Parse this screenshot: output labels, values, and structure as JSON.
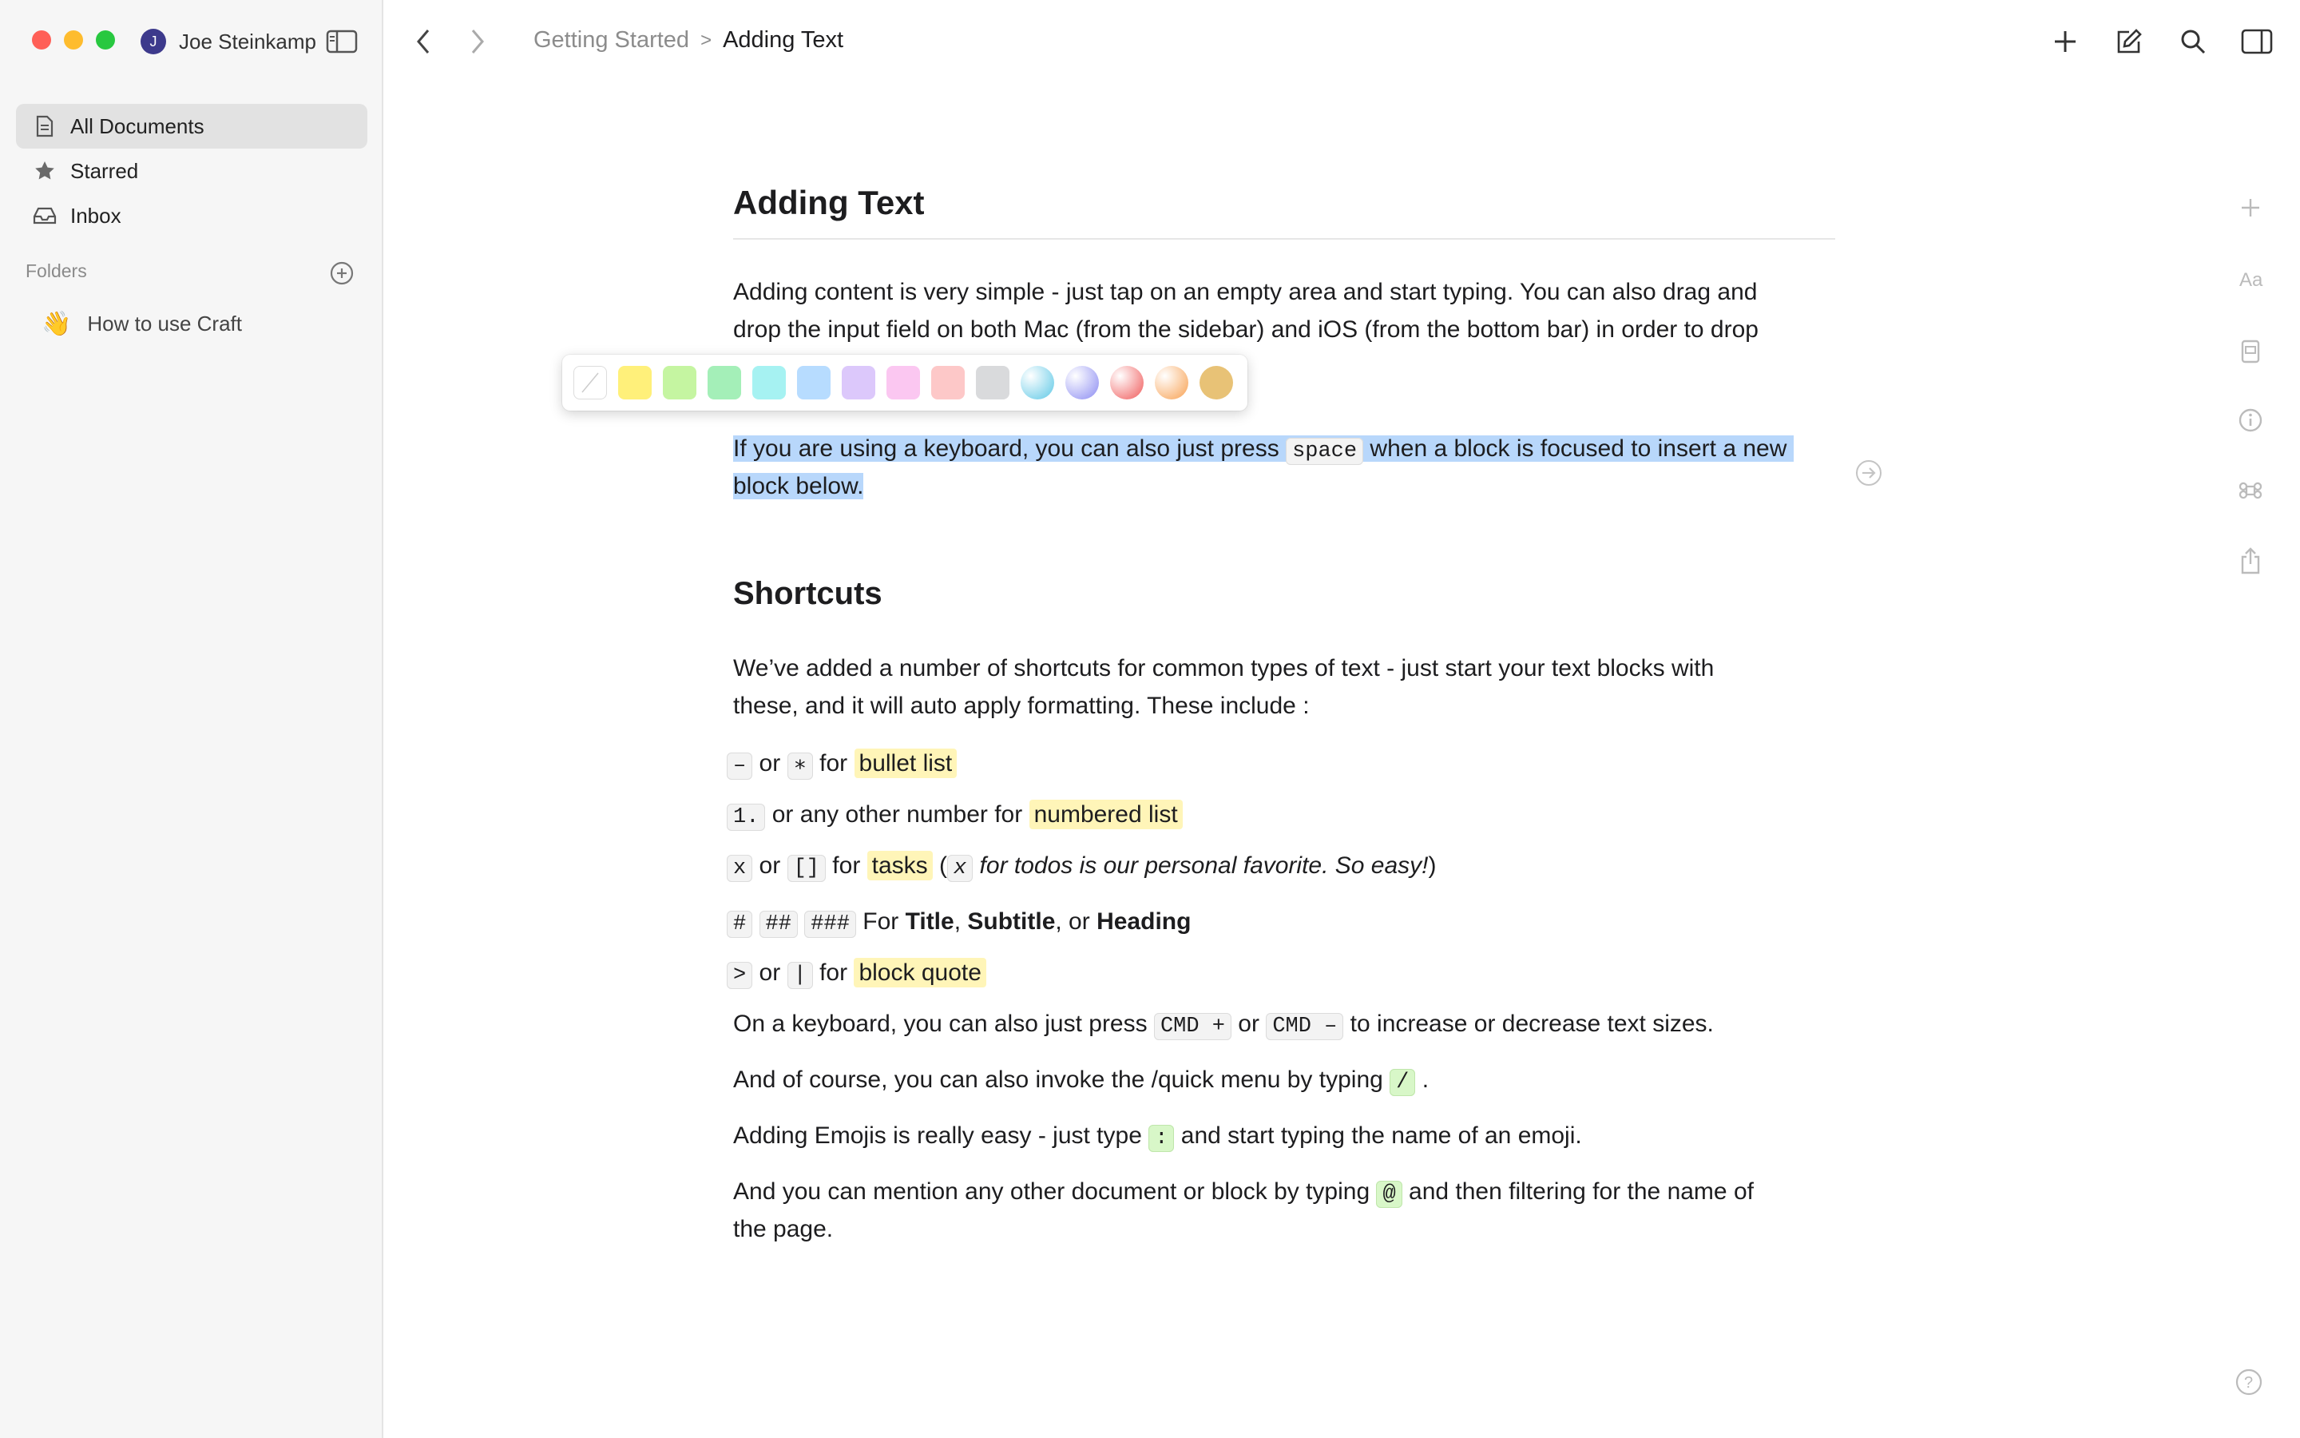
{
  "window": {
    "user_name": "Joe Steinkamp",
    "user_initial": "J"
  },
  "sidebar": {
    "items": [
      {
        "label": "All Documents",
        "icon": "document-icon"
      },
      {
        "label": "Starred",
        "icon": "star-icon"
      },
      {
        "label": "Inbox",
        "icon": "inbox-icon"
      }
    ],
    "folders_label": "Folders",
    "folders": [
      {
        "label": "How to use Craft",
        "emoji": "👋"
      }
    ]
  },
  "breadcrumb": {
    "parent": "Getting Started",
    "separator": ">",
    "current": "Adding Text"
  },
  "toolbar_colors": [
    "#f2f2f2",
    "#fff07a",
    "#c5f5a1",
    "#a4efb8",
    "#a6f2f2",
    "#b7dcff",
    "#dcc8fb",
    "#fbc7f1",
    "#fdc8c8",
    "#d9dadc",
    "#5ec8e6",
    "#8b8bf2",
    "#f05a5a",
    "#f8a050",
    "#e8c276"
  ],
  "doc": {
    "title": "Adding Text",
    "p1_line1": "Adding content is very simple - just tap on an empty area and start typing. You can also drag and",
    "p1_line2": "drop the input field on both Mac (from the sidebar) and iOS (from the bottom bar) in order to drop",
    "p2_a": "If you are using a keyboard, you can also just press ",
    "p2_code": "space",
    "p2_b": " when a block is focused to insert a new",
    "p2_line2": "block below.",
    "h2": "Shortcuts",
    "p3_line1": "We’ve added a number of shortcuts for common types of text - just start your text blocks with",
    "p3_line2": "these, and it will auto apply formatting. These include :",
    "s1": {
      "code1": "–",
      "or": " or ",
      "code2": "∗",
      "for": " for ",
      "hl": "bullet list"
    },
    "s2": {
      "code1": "1.",
      "text": " or any other number for ",
      "hl": "numbered list"
    },
    "s3": {
      "code1": "x",
      "or": " or ",
      "code2": "[]",
      "for": " for ",
      "hl": "tasks",
      "paren_open": " (",
      "code3": "x",
      "italic": " for todos is our personal favorite. So easy!",
      "paren_close": ")"
    },
    "s4": {
      "code1": "#",
      "code2": "##",
      "code3": "###",
      "text": " For ",
      "b1": "Title",
      "comma": ", ",
      "b2": "Subtitle",
      "or": ", or ",
      "b3": "Heading"
    },
    "s5": {
      "code1": ">",
      "or": " or ",
      "code2": "|",
      "for": " for ",
      "hl": "block quote"
    },
    "p4": {
      "a": "On a keyboard, you can also just press ",
      "code1": "CMD +",
      "or": " or ",
      "code2": "CMD –",
      "b": " to increase or decrease text sizes."
    },
    "p5": {
      "a": "And of course, you can also invoke the /quick menu by typing ",
      "code": "/",
      "b": " ."
    },
    "p6": {
      "a": "Adding Emojis is really easy - just type ",
      "code": ":",
      "b": " and start typing the name of an emoji."
    },
    "p7": {
      "a": "And you can mention any other document or block by typing ",
      "code": "@",
      "b": " and then filtering for the name of",
      "line2": "the page."
    }
  }
}
